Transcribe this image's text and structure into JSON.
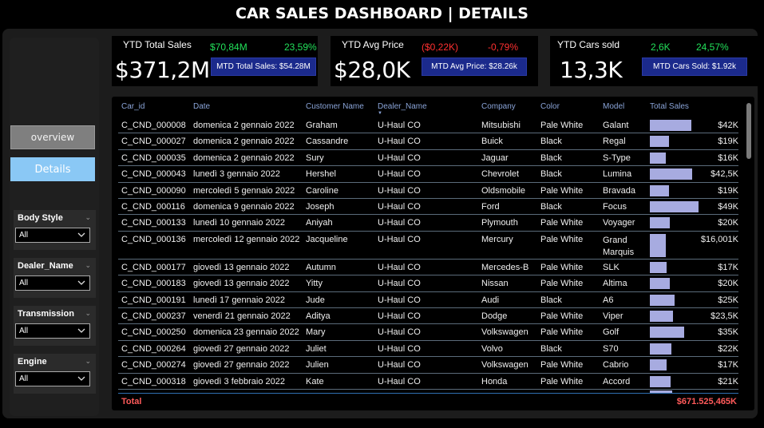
{
  "title": "CAR SALES DASHBOARD | DETAILS",
  "nav": {
    "overview": "overview",
    "details": "Details"
  },
  "slicers": [
    {
      "label": "Body Style",
      "value": "All"
    },
    {
      "label": "Dealer_Name",
      "value": "All"
    },
    {
      "label": "Transmission",
      "value": "All"
    },
    {
      "label": "Engine",
      "value": "All"
    }
  ],
  "kpis": [
    {
      "title": "YTD Total Sales",
      "value": "$371,2M",
      "delta1": "$70,84M",
      "delta2": "23,59%",
      "mtd": "MTD Total Sales: $54.28M",
      "delta1_color": "#22e05a",
      "delta2_color": "#22e05a"
    },
    {
      "title": "YTD Avg Price",
      "value": "$28,0K",
      "delta1": "($0,22K)",
      "delta2": "-0,79%",
      "mtd": "MTD Avg Price: $28.26k",
      "delta1_color": "#ff3030",
      "delta2_color": "#ff3030"
    },
    {
      "title": "YTD Cars sold",
      "value": "13,3K",
      "delta1": "2,6K",
      "delta2": "24,57%",
      "mtd": "MTD Cars Sold: $1.92k",
      "delta1_color": "#22e05a",
      "delta2_color": "#22e05a"
    }
  ],
  "table": {
    "headers": [
      "Car_id",
      "Date",
      "Customer Name",
      "Dealer_Name",
      "Company",
      "Color",
      "Model",
      "Total Sales"
    ],
    "rows": [
      {
        "car_id": "C_CND_000008",
        "date": "domenica 2 gennaio 2022",
        "customer": "Graham",
        "dealer": "U-Haul CO",
        "company": "Mitsubishi",
        "color": "Pale White",
        "model": "Galant",
        "sales": "$42K",
        "value": 42000
      },
      {
        "car_id": "C_CND_000027",
        "date": "domenica 2 gennaio 2022",
        "customer": "Cassandre",
        "dealer": "U-Haul CO",
        "company": "Buick",
        "color": "Black",
        "model": "Regal",
        "sales": "$19K",
        "value": 19000
      },
      {
        "car_id": "C_CND_000035",
        "date": "domenica 2 gennaio 2022",
        "customer": "Sury",
        "dealer": "U-Haul CO",
        "company": "Jaguar",
        "color": "Black",
        "model": "S-Type",
        "sales": "$16K",
        "value": 16000
      },
      {
        "car_id": "C_CND_000043",
        "date": "lunedì 3 gennaio 2022",
        "customer": "Hershel",
        "dealer": "U-Haul CO",
        "company": "Chevrolet",
        "color": "Black",
        "model": "Lumina",
        "sales": "$42,5K",
        "value": 42500
      },
      {
        "car_id": "C_CND_000090",
        "date": "mercoledì 5 gennaio 2022",
        "customer": "Caroline",
        "dealer": "U-Haul CO",
        "company": "Oldsmobile",
        "color": "Pale White",
        "model": "Bravada",
        "sales": "$19K",
        "value": 19000
      },
      {
        "car_id": "C_CND_000116",
        "date": "domenica 9 gennaio 2022",
        "customer": "Joseph",
        "dealer": "U-Haul CO",
        "company": "Ford",
        "color": "Black",
        "model": "Focus",
        "sales": "$49K",
        "value": 49000
      },
      {
        "car_id": "C_CND_000133",
        "date": "lunedì 10 gennaio 2022",
        "customer": "Aniyah",
        "dealer": "U-Haul CO",
        "company": "Plymouth",
        "color": "Pale White",
        "model": "Voyager",
        "sales": "$20K",
        "value": 20000
      },
      {
        "car_id": "C_CND_000136",
        "date": "mercoledì 12 gennaio 2022",
        "customer": "Jacqueline",
        "dealer": "U-Haul CO",
        "company": "Mercury",
        "color": "Pale White",
        "model": "Grand Marquis",
        "sales": "$16,001K",
        "value": 16001
      },
      {
        "car_id": "C_CND_000177",
        "date": "giovedì 13 gennaio 2022",
        "customer": "Autumn",
        "dealer": "U-Haul CO",
        "company": "Mercedes-B",
        "color": "Pale White",
        "model": "SLK",
        "sales": "$17K",
        "value": 17000
      },
      {
        "car_id": "C_CND_000183",
        "date": "giovedì 13 gennaio 2022",
        "customer": "Yitty",
        "dealer": "U-Haul CO",
        "company": "Nissan",
        "color": "Pale White",
        "model": "Altima",
        "sales": "$20K",
        "value": 20000
      },
      {
        "car_id": "C_CND_000191",
        "date": "lunedì 17 gennaio 2022",
        "customer": "Jude",
        "dealer": "U-Haul CO",
        "company": "Audi",
        "color": "Black",
        "model": "A6",
        "sales": "$25K",
        "value": 25000
      },
      {
        "car_id": "C_CND_000237",
        "date": "venerdì 21 gennaio 2022",
        "customer": "Aditya",
        "dealer": "U-Haul CO",
        "company": "Dodge",
        "color": "Pale White",
        "model": "Viper",
        "sales": "$23,5K",
        "value": 23500
      },
      {
        "car_id": "C_CND_000250",
        "date": "domenica 23 gennaio 2022",
        "customer": "Mary",
        "dealer": "U-Haul CO",
        "company": "Volkswagen",
        "color": "Pale White",
        "model": "Golf",
        "sales": "$35K",
        "value": 35000
      },
      {
        "car_id": "C_CND_000264",
        "date": "giovedì 27 gennaio 2022",
        "customer": "Juliet",
        "dealer": "U-Haul CO",
        "company": "Volvo",
        "color": "Black",
        "model": "S70",
        "sales": "$22K",
        "value": 22000
      },
      {
        "car_id": "C_CND_000274",
        "date": "giovedì 27 gennaio 2022",
        "customer": "Julien",
        "dealer": "U-Haul CO",
        "company": "Volkswagen",
        "color": "Pale White",
        "model": "Cabrio",
        "sales": "$17K",
        "value": 17000
      },
      {
        "car_id": "C_CND_000318",
        "date": "giovedì 3 febbraio 2022",
        "customer": "Kate",
        "dealer": "U-Haul CO",
        "company": "Honda",
        "color": "Pale White",
        "model": "Accord",
        "sales": "$21K",
        "value": 21000
      }
    ],
    "total_label": "Total",
    "total_value": "$671.525,465K",
    "bar_max": 50000
  },
  "colors": {
    "accent_blue": "#1b2a8c",
    "bar": "#a7abe0",
    "positive": "#22e05a",
    "negative": "#ff3030",
    "header_text": "#8aa4d8"
  }
}
